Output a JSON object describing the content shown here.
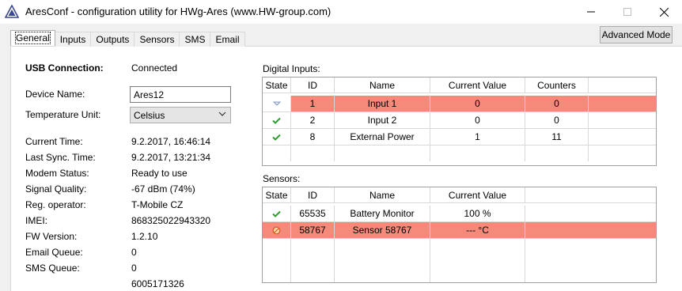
{
  "window": {
    "title": "AresConf - configuration utility for HWg-Ares (www.HW-group.com)",
    "minimize": "—",
    "maximize": "☐",
    "close": "✕"
  },
  "tabs": [
    "General",
    "Inputs",
    "Outputs",
    "Sensors",
    "SMS",
    "Email"
  ],
  "advanced_button": "Advanced Mode",
  "general": {
    "usb_label": "USB Connection:",
    "usb_value": "Connected",
    "device_name_label": "Device Name:",
    "device_name_value": "Ares12",
    "temp_unit_label": "Temperature Unit:",
    "temp_unit_value": "Celsius",
    "current_time_label": "Current Time:",
    "current_time_value": "9.2.2017, 16:46:14",
    "last_sync_label": "Last Sync. Time:",
    "last_sync_value": "9.2.2017, 13:21:34",
    "modem_status_label": "Modem Status:",
    "modem_status_value": "Ready to use",
    "signal_label": "Signal Quality:",
    "signal_value": "-67 dBm (74%)",
    "operator_label": "Reg. operator:",
    "operator_value": "T-Mobile CZ",
    "imei_label": "IMEI:",
    "imei_value": "868325022943320",
    "fw_label": "FW Version:",
    "fw_value": "1.2.10",
    "email_queue_label": "Email Queue:",
    "email_queue_value": "0",
    "sms_queue_label": "SMS Queue:",
    "sms_queue_value": "0",
    "extra_value": "6005171326"
  },
  "digital_inputs": {
    "label": "Digital Inputs:",
    "headers": [
      "State",
      "ID",
      "Name",
      "Current Value",
      "Counters"
    ],
    "rows": [
      {
        "state": "arrow",
        "id": "1",
        "name": "Input 1",
        "value": "0",
        "counter": "0",
        "highlight": true
      },
      {
        "state": "ok",
        "id": "2",
        "name": "Input 2",
        "value": "0",
        "counter": "0",
        "highlight": false
      },
      {
        "state": "ok",
        "id": "8",
        "name": "External Power",
        "value": "1",
        "counter": "11",
        "highlight": false
      }
    ]
  },
  "sensors": {
    "label": "Sensors:",
    "headers": [
      "State",
      "ID",
      "Name",
      "Current Value"
    ],
    "rows": [
      {
        "state": "ok",
        "id": "65535",
        "name": "Battery Monitor",
        "value": "100 %",
        "highlight": false
      },
      {
        "state": "error",
        "id": "58767",
        "name": "Sensor 58767",
        "value": "--- °C",
        "highlight": true
      }
    ]
  },
  "colors": {
    "highlight_row": "#f58a7a",
    "ok_icon": "#2e9e2e",
    "error_icon": "#e2501c"
  }
}
